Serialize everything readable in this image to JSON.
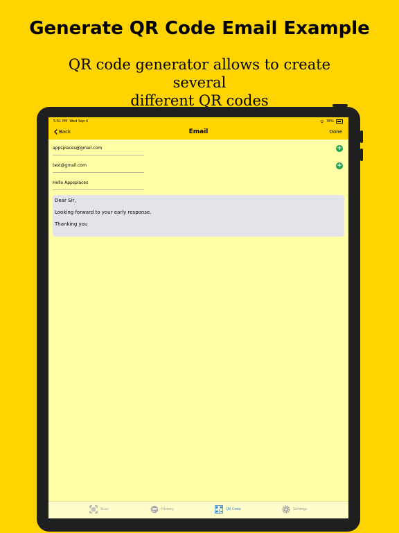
{
  "promo": {
    "headline": "Generate QR Code Email Example",
    "subtitle_line1": "QR code generator allows to create several",
    "subtitle_line2": "different QR codes"
  },
  "status": {
    "time": "5:51 PM",
    "date": "Wed Sep 4",
    "battery": "78%"
  },
  "nav": {
    "back_label": "Back",
    "title": "Email",
    "done_label": "Done"
  },
  "form": {
    "to": "appsplaces@gmail.com",
    "cc": "test@gmail.com",
    "subject": "Hello Appsplaces",
    "body": [
      "Dear Sir,",
      "Looking forward to your early response.",
      "Thanking you"
    ]
  },
  "tabs": [
    {
      "label": "Scan",
      "icon": "scan-icon"
    },
    {
      "label": "History",
      "icon": "history-icon"
    },
    {
      "label": "QR Code",
      "icon": "qr-code-icon",
      "active": true
    },
    {
      "label": "Settings",
      "icon": "gear-icon"
    }
  ],
  "colors": {
    "background": "#FFD400",
    "screen": "#FFFDA6",
    "accent": "#2a7fd4",
    "add": "#1fa34a"
  }
}
